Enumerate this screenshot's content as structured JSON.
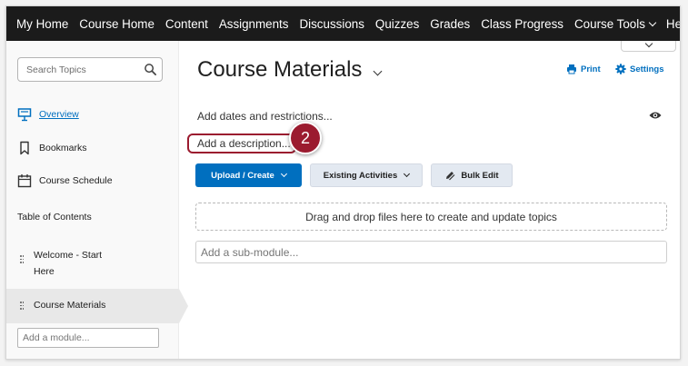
{
  "navbar": {
    "items": [
      {
        "label": "My Home",
        "dropdown": false
      },
      {
        "label": "Course Home",
        "dropdown": false
      },
      {
        "label": "Content",
        "dropdown": false
      },
      {
        "label": "Assignments",
        "dropdown": false
      },
      {
        "label": "Discussions",
        "dropdown": false
      },
      {
        "label": "Quizzes",
        "dropdown": false
      },
      {
        "label": "Grades",
        "dropdown": false
      },
      {
        "label": "Class Progress",
        "dropdown": false
      },
      {
        "label": "Course Tools",
        "dropdown": true
      },
      {
        "label": "Help",
        "dropdown": true
      }
    ]
  },
  "sidebar": {
    "search_placeholder": "Search Topics",
    "links": [
      {
        "label": "Overview",
        "icon": "presentation-board-icon",
        "active": true
      },
      {
        "label": "Bookmarks",
        "icon": "bookmark-icon",
        "active": false
      },
      {
        "label": "Course Schedule",
        "icon": "calendar-icon",
        "active": false
      }
    ],
    "toc_heading": "Table of Contents",
    "toc_items": [
      {
        "line1": "Welcome - Start",
        "line2": "Here",
        "selected": false
      },
      {
        "line1": "Course Materials",
        "line2": "",
        "selected": true
      }
    ],
    "add_module_placeholder": "Add a module..."
  },
  "main": {
    "title": "Course Materials",
    "print_label": "Print",
    "settings_label": "Settings",
    "dates_link": "Add dates and restrictions...",
    "description_link": "Add a description...",
    "step_number": "2",
    "buttons": {
      "upload_create": "Upload / Create",
      "existing_activities": "Existing Activities",
      "bulk_edit": "Bulk Edit"
    },
    "dropzone_text": "Drag and drop files here to create and update topics",
    "submodule_placeholder": "Add a sub-module..."
  },
  "colors": {
    "navbar_bg": "#1b1b1b",
    "accent_blue": "#006fbf",
    "callout_red": "#9b1b2f"
  }
}
